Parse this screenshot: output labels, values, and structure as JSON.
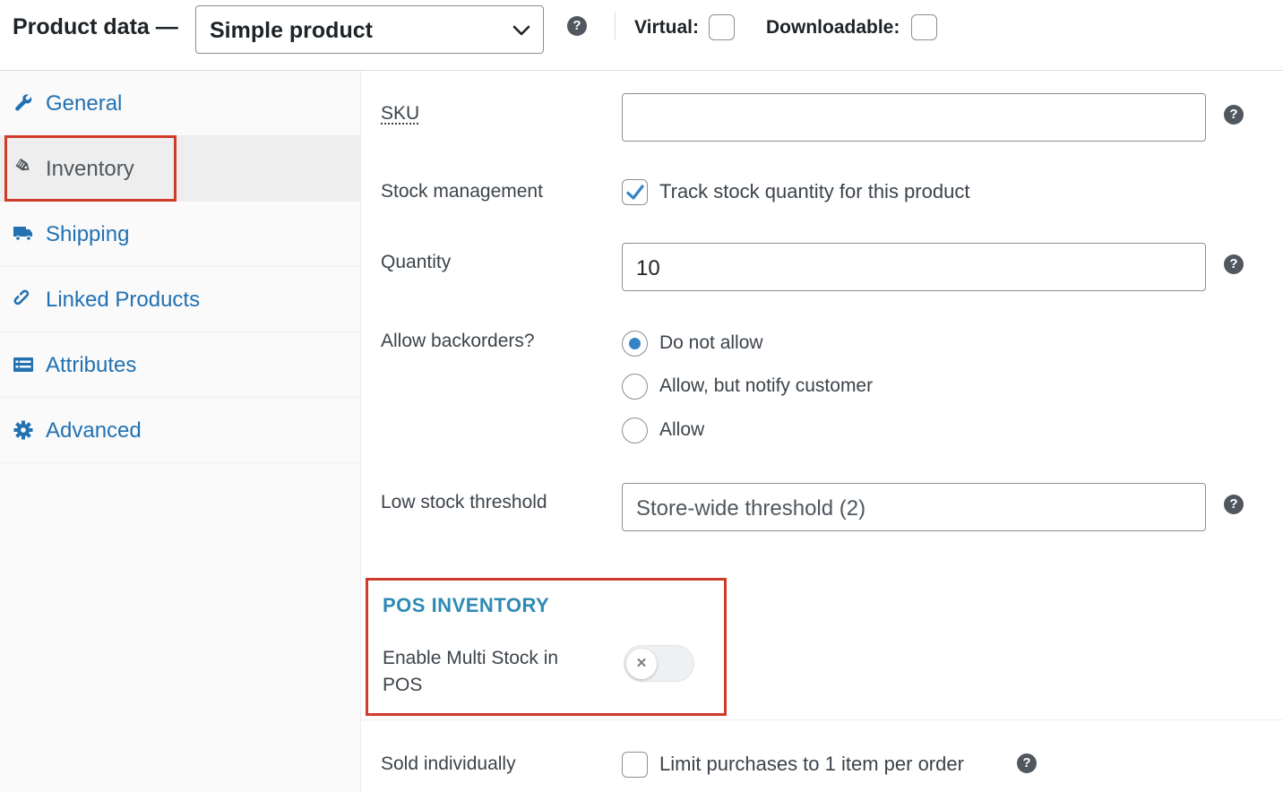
{
  "header": {
    "title": "Product data —",
    "product_type": "Simple product",
    "virtual_label": "Virtual:",
    "virtual_checked": false,
    "downloadable_label": "Downloadable:",
    "downloadable_checked": false
  },
  "help_glyph": "?",
  "sidebar": {
    "tabs": [
      {
        "label": "General",
        "icon": "wrench-icon",
        "active": false
      },
      {
        "label": "Inventory",
        "icon": "tag-icon",
        "active": true
      },
      {
        "label": "Shipping",
        "icon": "truck-icon",
        "active": false
      },
      {
        "label": "Linked Products",
        "icon": "link-icon",
        "active": false
      },
      {
        "label": "Attributes",
        "icon": "list-icon",
        "active": false
      },
      {
        "label": "Advanced",
        "icon": "gear-icon",
        "active": false
      }
    ]
  },
  "inventory": {
    "sku_label": "SKU",
    "sku_value": "",
    "stock_management_label": "Stock management",
    "track_stock_label": "Track stock quantity for this product",
    "track_stock_checked": true,
    "quantity_label": "Quantity",
    "quantity_value": "10",
    "backorders_label": "Allow backorders?",
    "backorder_options": [
      "Do not allow",
      "Allow, but notify customer",
      "Allow"
    ],
    "backorder_selected": "Do not allow",
    "low_stock_label": "Low stock threshold",
    "low_stock_placeholder": "Store-wide threshold (2)",
    "pos_section_title": "POS INVENTORY",
    "multi_stock_label": "Enable Multi Stock in POS",
    "multi_stock_enabled": false,
    "toggle_off_glyph": "×",
    "sold_individually_label": "Sold individually",
    "limit_purchases_label": "Limit purchases to 1 item per order",
    "limit_purchases_checked": false
  },
  "colors": {
    "accent": "#2271b1",
    "radio_selected": "#3582c4",
    "pos_title": "#2e8ab5",
    "highlight_border": "#d03a2b"
  }
}
